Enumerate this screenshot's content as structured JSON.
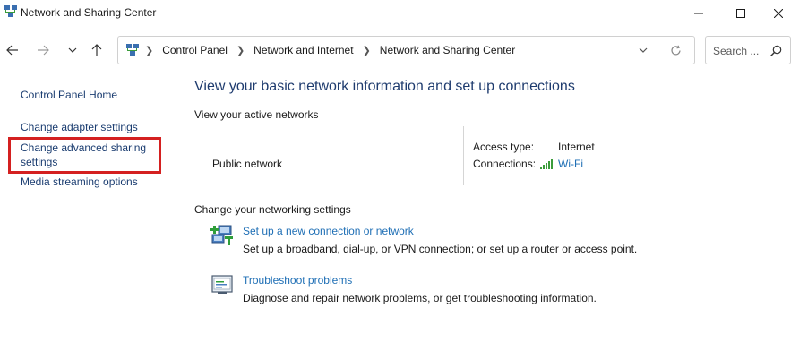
{
  "window": {
    "title": "Network and Sharing Center",
    "icon": "network-center-icon"
  },
  "address_bar": {
    "breadcrumbs": [
      "Control Panel",
      "Network and Internet",
      "Network and Sharing Center"
    ]
  },
  "search": {
    "placeholder": "Search ..."
  },
  "left_pane": {
    "links": [
      "Control Panel Home",
      "Change adapter settings",
      "Change advanced sharing settings",
      "Media streaming options"
    ],
    "highlight_color": "#d42020"
  },
  "main": {
    "title": "View your basic network information and set up connections",
    "active_networks_heading": "View your active networks",
    "network": {
      "name": "Public network",
      "access_type_label": "Access type:",
      "access_type_value": "Internet",
      "connections_label": "Connections:",
      "connection_name": "Wi-Fi"
    },
    "change_settings_heading": "Change your networking settings",
    "tasks": [
      {
        "icon": "new-connection-icon",
        "link": "Set up a new connection or network",
        "description": "Set up a broadband, dial-up, or VPN connection; or set up a router or access point."
      },
      {
        "icon": "troubleshoot-icon",
        "link": "Troubleshoot problems",
        "description": "Diagnose and repair network problems, or get troubleshooting information."
      }
    ]
  },
  "colors": {
    "heading_blue": "#1e3b6e",
    "link_blue": "#1f6fb5",
    "left_link": "#1a3c70"
  }
}
